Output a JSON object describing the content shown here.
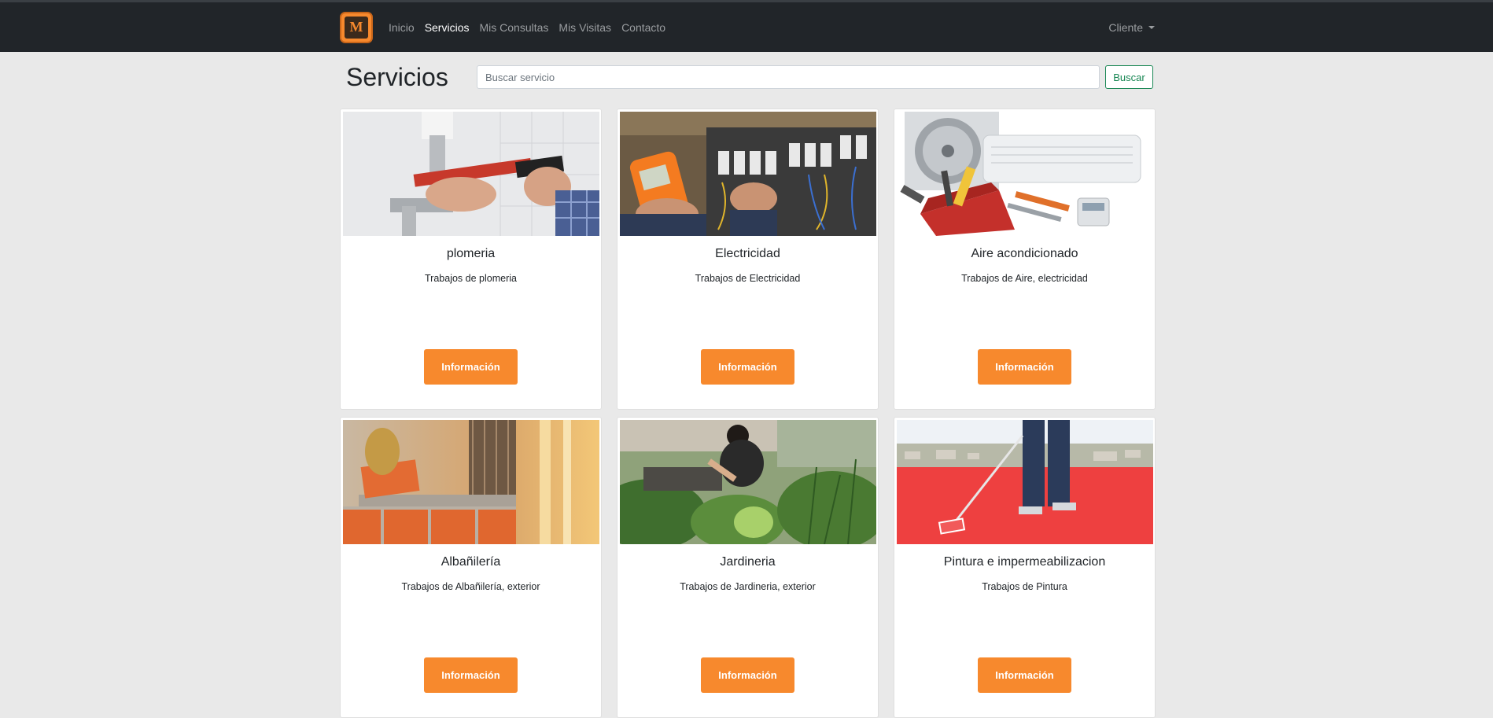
{
  "navbar": {
    "logo": "maestros-logo",
    "links": [
      {
        "label": "Inicio",
        "active": false
      },
      {
        "label": "Servicios",
        "active": true
      },
      {
        "label": "Mis Consultas",
        "active": false
      },
      {
        "label": "Mis Visitas",
        "active": false
      },
      {
        "label": "Contacto",
        "active": false
      }
    ],
    "user_menu": "Cliente"
  },
  "page": {
    "title": "Servicios",
    "search_placeholder": "Buscar servicio",
    "search_button": "Buscar"
  },
  "services": [
    {
      "title": "plomeria",
      "description": "Trabajos de plomeria",
      "button": "Información",
      "image": "plumbing-photo"
    },
    {
      "title": "Electricidad",
      "description": "Trabajos de Electricidad",
      "button": "Información",
      "image": "electrical-panel-photo"
    },
    {
      "title": "Aire acondicionado",
      "description": "Trabajos de Aire, electricidad",
      "button": "Información",
      "image": "air-conditioner-tools-photo"
    },
    {
      "title": "Albañilería",
      "description": "Trabajos de Albañilería, exterior",
      "button": "Información",
      "image": "bricklaying-photo"
    },
    {
      "title": "Jardineria",
      "description": "Trabajos de Jardineria, exterior",
      "button": "Información",
      "image": "gardening-photo"
    },
    {
      "title": "Pintura e impermeabilizacion",
      "description": "Trabajos de Pintura",
      "button": "Información",
      "image": "roof-painting-photo"
    }
  ],
  "colors": {
    "navbar": "#212529",
    "accent": "#f7892d",
    "search_button": "#198754",
    "background": "#e9e9e9"
  }
}
